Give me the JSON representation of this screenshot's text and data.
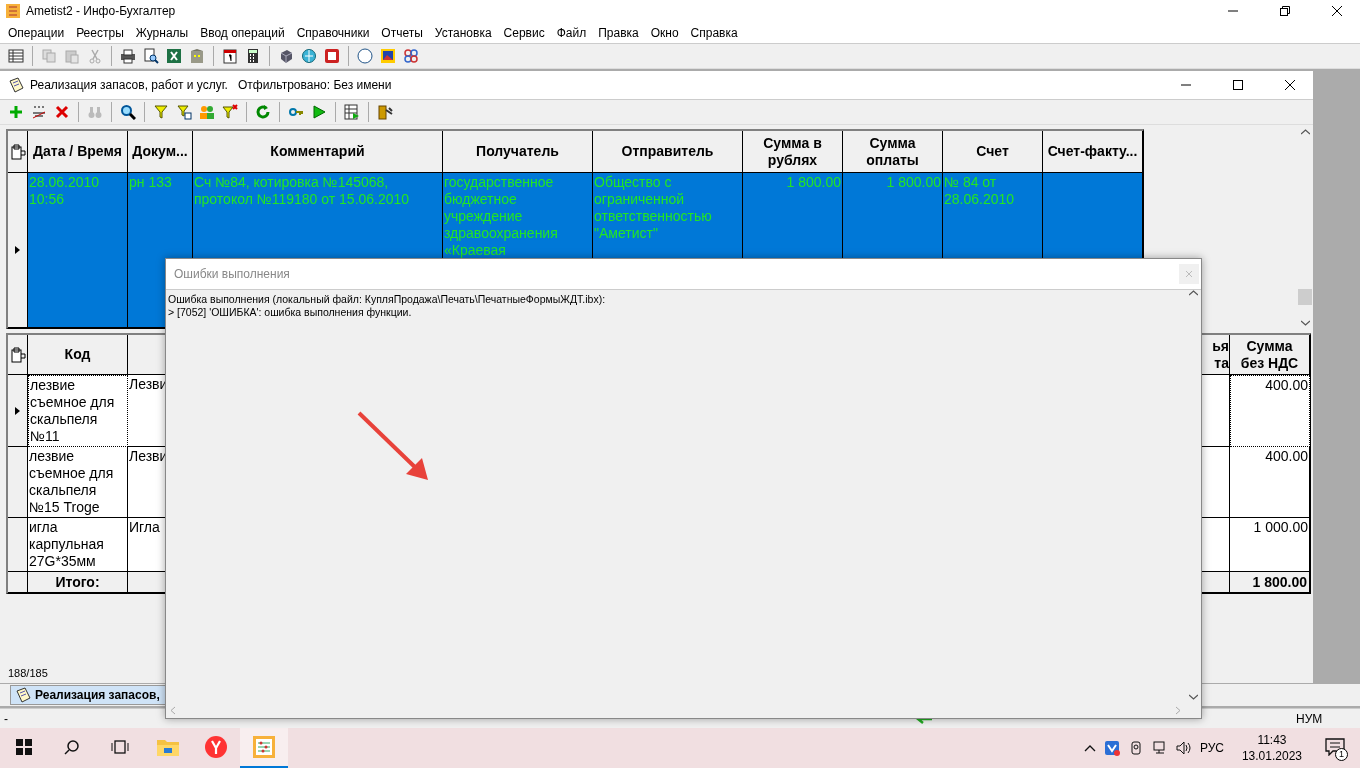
{
  "window": {
    "title": "Ametist2 - Инфо-Бухгалтер"
  },
  "menu": [
    "Операции",
    "Реестры",
    "Журналы",
    "Ввод операций",
    "Справочники",
    "Отчеты",
    "Установка",
    "Сервис",
    "Файл",
    "Правка",
    "Окно",
    "Справка"
  ],
  "child_window": {
    "title": "Реализация запасов, работ и услуг.   Отфильтровано: Без имени"
  },
  "journal": {
    "columns": [
      "Дата / Время",
      "Докум...",
      "Комментарий",
      "Получатель",
      "Отправитель",
      "Сумма в рублях",
      "Сумма оплаты",
      "Счет",
      "Счет-факту..."
    ],
    "rows": [
      {
        "selected": true,
        "cells": [
          "28.06.2010 10:56",
          "рн 133",
          "Сч №84, котировка №145068, протокол №119180 от 15.06.2010",
          "государственное бюджетное учреждение здравоохранения «Краевая",
          "Общество с ограниченной ответственностью \"Аметист\"",
          "1 800.00",
          "1 800.00",
          "№ 84 от 28.06.2010"
        ]
      }
    ]
  },
  "lines": {
    "columns": [
      "Код",
      "ья та",
      "Сумма без НДС"
    ],
    "rows": [
      {
        "selected": true,
        "code": "лезвие съемное для скальпеля №11",
        "name": "Лезви",
        "sum": "400.00"
      },
      {
        "selected": false,
        "code": "лезвие съемное для скальпеля №15 Troge",
        "name": "Лезви",
        "sum": "400.00"
      },
      {
        "selected": false,
        "code": "игла карпульная 27G*35мм",
        "name": "Игла",
        "sum": "1 000.00"
      }
    ],
    "total": {
      "label": "Итого:",
      "sum": "1 800.00"
    }
  },
  "record_count": "188/185",
  "mdi_tabs": [
    {
      "label": "Реализация запасов,",
      "selected": true
    }
  ],
  "status_bar": [
    "-",
    "НУМ"
  ],
  "dialog": {
    "title": "Ошибки выполнения",
    "lines": [
      "Ошибка выполнения (локальный файл: КупляПродажа\\Печать\\ПечатныеФормыЖДТ.ibx):",
      "> [7052] 'ОШИБКА': ошибка выполнения функции."
    ]
  },
  "taskbar": {
    "apps": [
      {
        "kind": "folder",
        "selected": false
      },
      {
        "kind": "browser",
        "selected": false
      },
      {
        "kind": "accounting",
        "selected": true
      }
    ],
    "language": "РУС",
    "time": "11:43",
    "date": "13.01.2023",
    "notifications": "1"
  }
}
